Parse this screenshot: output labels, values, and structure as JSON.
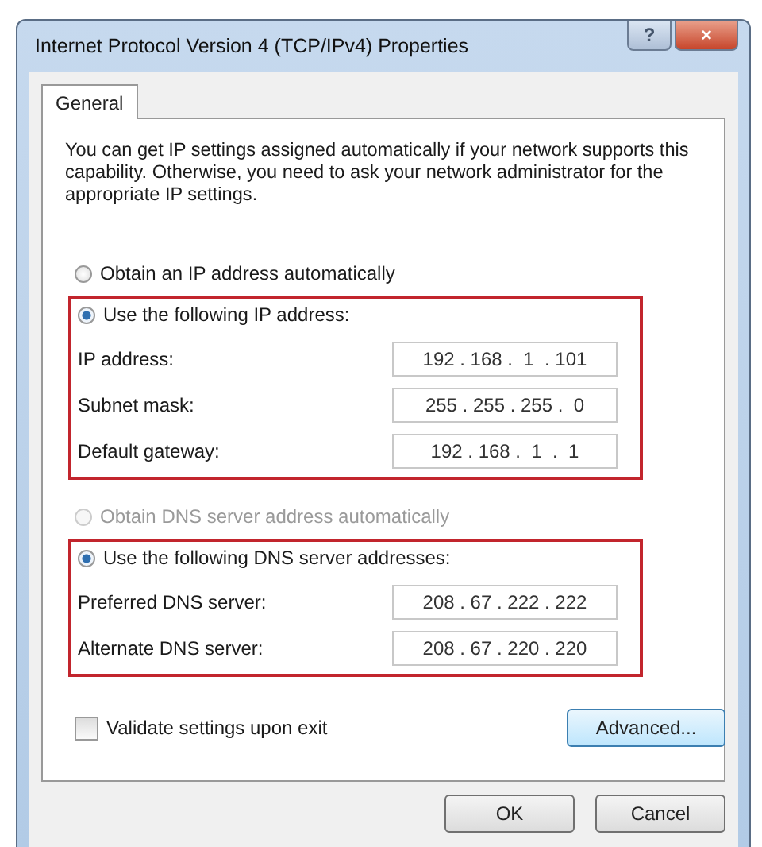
{
  "window": {
    "title": "Internet Protocol Version 4 (TCP/IPv4) Properties",
    "help_button": "?",
    "close_button": "×"
  },
  "tabs": [
    {
      "label": "General",
      "selected": true
    }
  ],
  "description": "You can get IP settings assigned automatically if your network supports this capability. Otherwise, you need to ask your network administrator for the appropriate IP settings.",
  "sections": [
    {
      "auto_option": {
        "label": "Obtain an IP address automatically",
        "selected": false,
        "disabled": false
      },
      "manual_option": {
        "label": "Use the following IP address:",
        "selected": true,
        "disabled": false
      },
      "highlighted": true,
      "fields": [
        {
          "label": "IP address:",
          "value": "192 . 168 .  1  . 101"
        },
        {
          "label": "Subnet mask:",
          "value": "255 . 255 . 255 .  0"
        },
        {
          "label": "Default gateway:",
          "value": "192 . 168 .  1  .  1"
        }
      ]
    },
    {
      "auto_option": {
        "label": "Obtain DNS server address automatically",
        "selected": false,
        "disabled": true
      },
      "manual_option": {
        "label": "Use the following DNS server addresses:",
        "selected": true,
        "disabled": false
      },
      "highlighted": true,
      "fields": [
        {
          "label": "Preferred DNS server:",
          "value": "208 . 67 . 222 . 222"
        },
        {
          "label": "Alternate DNS server:",
          "value": "208 . 67 . 220 . 220"
        }
      ]
    }
  ],
  "validate": {
    "label": "Validate settings upon exit",
    "checked": false
  },
  "advanced_button": "Advanced...",
  "buttons": [
    "OK",
    "Cancel"
  ]
}
